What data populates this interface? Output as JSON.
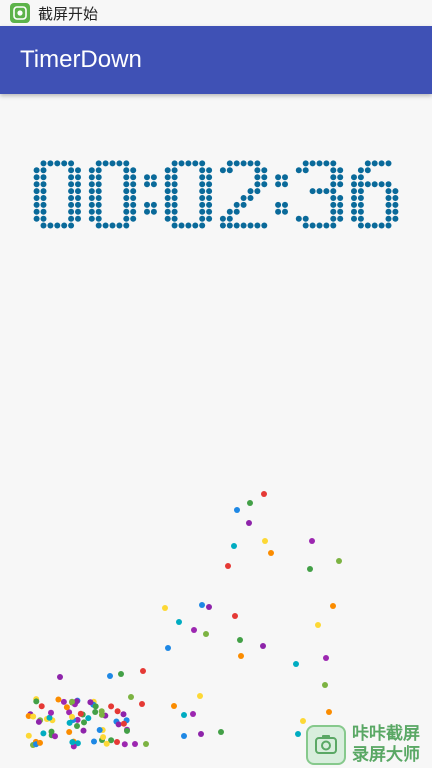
{
  "status_bar": {
    "title": "截屏开始",
    "icon": "screenshot-icon"
  },
  "app_bar": {
    "title": "TimerDown",
    "color": "#3f51b5"
  },
  "timer": {
    "display": "00:02:36",
    "dot_color": "#0a6a9a"
  },
  "watermark": {
    "line1": "咔咔截屏",
    "line2": "录屏大师",
    "color": "#5aa865"
  },
  "particle_colors": [
    "#e53935",
    "#43a047",
    "#1e88e5",
    "#8e24aa",
    "#fdd835",
    "#fb8c00",
    "#00acc1",
    "#9c27b0",
    "#7cb342"
  ]
}
